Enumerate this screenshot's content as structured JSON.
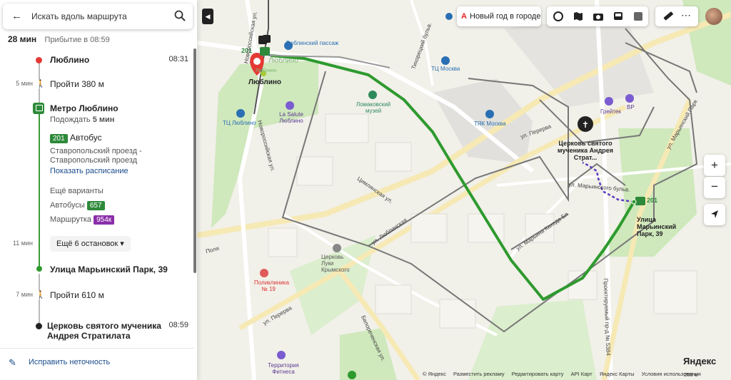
{
  "search": {
    "placeholder": "Искать вдоль маршрута"
  },
  "summary": {
    "duration": "28 мин",
    "arrival": "Прибытие в 08:59"
  },
  "route": {
    "start": {
      "name": "Люблино",
      "time": "08:31"
    },
    "walk1": {
      "minutes": "5 мин",
      "text": "Пройти 380 м"
    },
    "stop1": {
      "name": "Метро Люблино",
      "wait_label": "Подождать",
      "wait_value": "5 мин"
    },
    "bus": {
      "number": "201",
      "type": "Автобус",
      "direction": "Ставропольский проезд - Ставропольский проезд",
      "schedule_link": "Показать расписание"
    },
    "alternatives": {
      "title": "Ещё варианты",
      "buses_label": "Автобусы",
      "buses_value": "657",
      "minibus_label": "Маршрутка",
      "minibus_value": "954к"
    },
    "ride": {
      "minutes": "11 мин",
      "more_stops": "Ещё 6 остановок"
    },
    "stop2": {
      "name": "Улица Марьинский Парк, 39"
    },
    "walk2": {
      "minutes": "7 мин",
      "text": "Пройти 610 м"
    },
    "end": {
      "name_line1": "Церковь святого мученика",
      "name_line2": "Андрея Стратилата",
      "time": "08:59"
    }
  },
  "fix_error": "Исправить неточность",
  "toolbar": {
    "new_year": "Новый год в городе"
  },
  "map_labels": {
    "lublino": "Люблино",
    "lublino_passage": "Люблинский пассаж",
    "lublino_green": "Люблино",
    "tc_lublino": "ТЦ Люблино",
    "lasalute": "La Salute Люблино",
    "lomakovsky": "Ломаковский музей",
    "tyak_moskva": "ТЯК Москва",
    "tc_moskva": "ТЦ Москва",
    "graitek": "Грейтек",
    "vr": "ВР",
    "church": "Церковь святого мученика Андрея Страт...",
    "stop_marinsky": "Улица Марьинский Парк, 39",
    "stop_marinsky_bus": "201",
    "bus_201_start": "201",
    "poliklinika": "Поликлиника № 19",
    "church_luki": "Церковь Луки Крымского",
    "territoria": "Территория Фитнеса",
    "lublino_metro": "Люблино",
    "street_novorossiyskaya_1": "Новороссийская ул.",
    "street_novorossiyskaya_2": "Новороссийская ул.",
    "street_tikhoretsky": "Тихорецкий бульв.",
    "street_tsimlyanskaya": "Цимлянская ул.",
    "street_pererva_1": "ул. Перерва",
    "street_pererva_2": "ул. Перерва",
    "street_maryinsky": "ул. Марьинский Парк",
    "street_kakhovskaya": "ул. Марьина Кахеда Бл",
    "street_belorechenskaya": "Белореченская ул.",
    "street_polya": "Поля",
    "street_marynogo_bul": "ул. Марьинского бульв.",
    "street_proektiruemy": "Проектируемый пр-д № 5384",
    "street_lublinskaya": "ул. Люблинская"
  },
  "footer": {
    "copyright": "© Яндекс",
    "ads": "Разместить рекламу",
    "edit": "Редактировать карту",
    "api": "API Карт",
    "service": "Яндекс Карты",
    "terms": "Условия использования",
    "scale": "200 м"
  },
  "brand": "Яндекс",
  "colors": {
    "route_green": "#2e9a2e",
    "walk_purple": "#5b3bbf",
    "start_red": "#e53935",
    "map_roads": "#666666"
  }
}
